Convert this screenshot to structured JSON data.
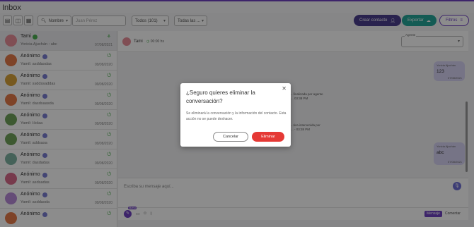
{
  "app": {
    "title": "Inbox"
  },
  "toolbar": {
    "search_type": "Nombre",
    "search_placeholder": "Juan Pérez",
    "filter_all": "Todos (101)",
    "filter_tags": "Todas las ...",
    "create_contact": "Crear contacto",
    "export": "Exportar",
    "filters": "Filtros"
  },
  "conversations": [
    {
      "name": "Tami",
      "sub": "Yoricia Ajuchán : abc",
      "date": "07/08/2021",
      "color": "#e98f9a",
      "active": true,
      "badge": false,
      "leaf": true
    },
    {
      "name": "Anónimo",
      "sub": "Yamil: asddasdas",
      "date": "09/08/2020",
      "color": "#e57a4a",
      "active": false,
      "badge": true,
      "leaf": false
    },
    {
      "name": "Anónimo",
      "sub": "Yamil: ssddssaddas",
      "date": "09/08/2020",
      "color": "#d9a23a",
      "active": false,
      "badge": true,
      "leaf": false
    },
    {
      "name": "Anónimo",
      "sub": "Yamil: dasdsaasda",
      "date": "09/08/2020",
      "color": "#e57a4a",
      "active": false,
      "badge": true,
      "leaf": false
    },
    {
      "name": "Anónimo",
      "sub": "Yamil: Holaa",
      "date": "09/08/2020",
      "color": "#6fa35a",
      "active": false,
      "badge": true,
      "leaf": false
    },
    {
      "name": "Anónimo",
      "sub": "Yamil: addsasa",
      "date": "09/08/2020",
      "color": "#6fa35a",
      "active": false,
      "badge": true,
      "leaf": false
    },
    {
      "name": "Anónimo",
      "sub": "Yamil: dasdadas",
      "date": "09/08/2020",
      "color": "#7fb3a3",
      "active": false,
      "badge": true,
      "leaf": false
    },
    {
      "name": "Anónimo",
      "sub": "Yamil: asdsadas",
      "date": "09/08/2020",
      "color": "#d96a8a",
      "active": false,
      "badge": true,
      "leaf": false
    },
    {
      "name": "Anónimo",
      "sub": "Yamil: asddasda",
      "date": "09/08/2020",
      "color": "#b88ad9",
      "active": false,
      "badge": true,
      "leaf": false
    },
    {
      "name": "Anónimo",
      "sub": "",
      "date": "",
      "color": "#e57a4a",
      "active": false,
      "badge": true,
      "leaf": false
    }
  ],
  "conversation": {
    "name": "Tami",
    "time": "00:00 hs",
    "agent_label": "Agente",
    "messages": [
      {
        "label": "Yoricia Ajuchán",
        "text": "123",
        "date": "07/08/2021"
      },
      {
        "label": "Yoricia Ajuchán",
        "text": "abc",
        "date": "07/08/2021"
      }
    ],
    "system_1": "...finalizada por agente\n... 03:38 PM",
    "system_2": "...tica intervenida por\n... - 03:38 PM",
    "composer_placeholder": "Escriba su mensaje aquí...",
    "nuevo_badge": "Nuevo",
    "mode_message": "Mensaje",
    "mode_comment": "Comentar"
  },
  "modal": {
    "title": "¿Seguro quieres eliminar la conversación?",
    "body": "Se eliminará la conversación y la información del contacto. Esta acción no se puede deshacer.",
    "cancel": "Cancelar",
    "confirm": "Eliminar"
  },
  "colors": {
    "accent": "#6f42c1",
    "danger": "#e53935",
    "export": "#26a69a",
    "create": "#4b3f8f"
  }
}
